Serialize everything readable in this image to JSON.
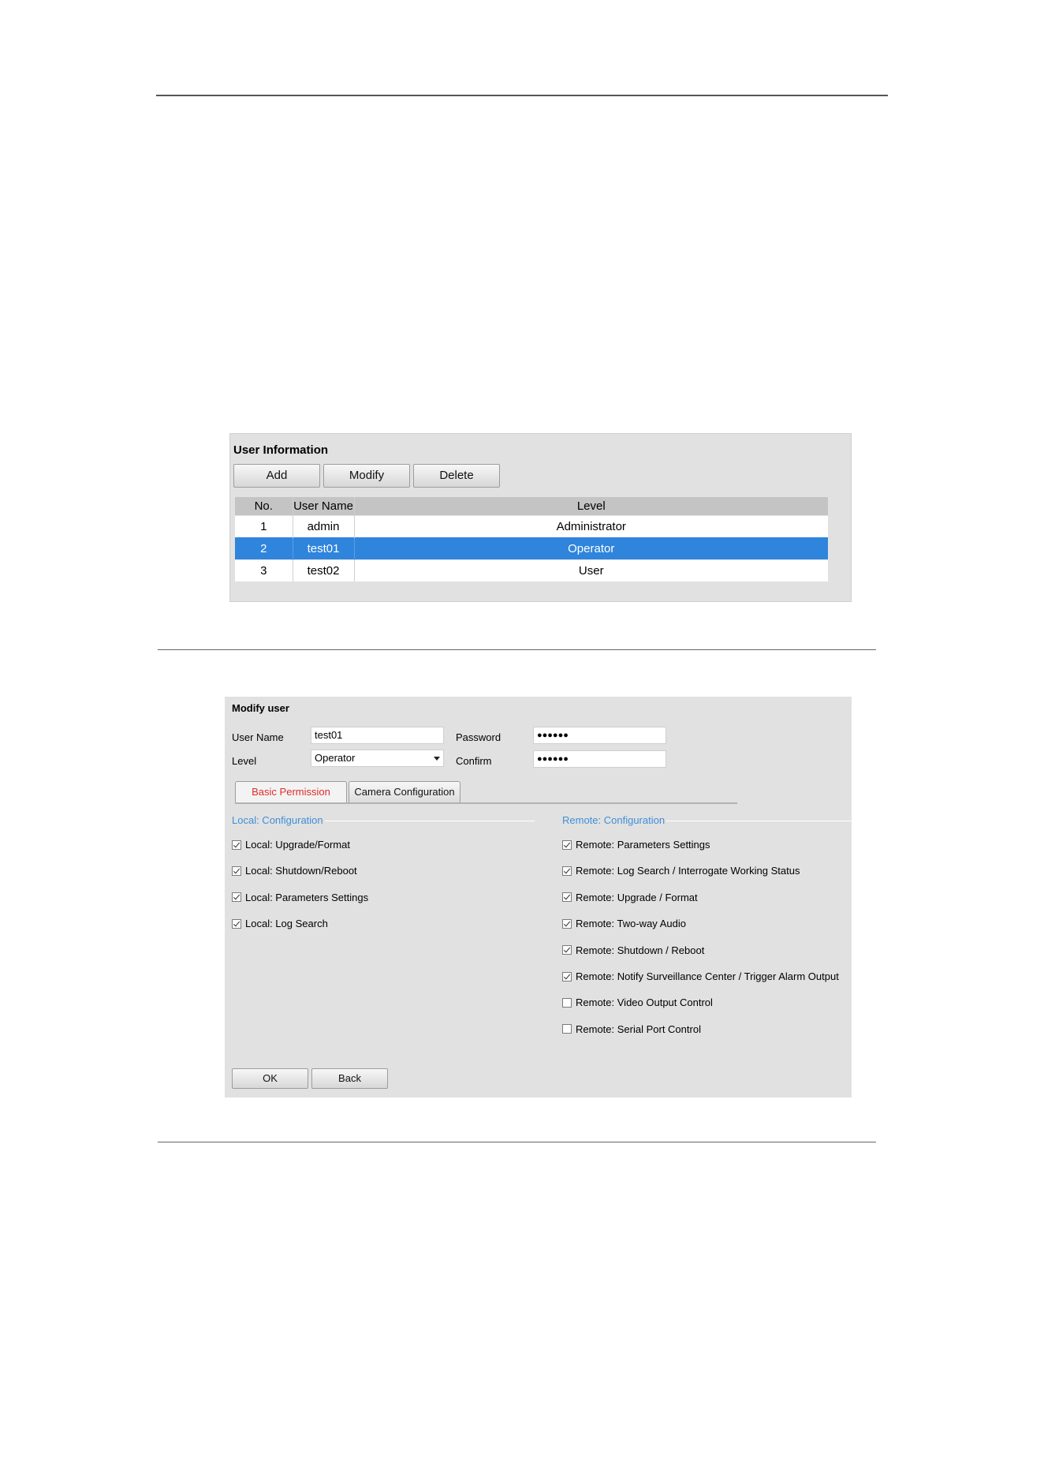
{
  "user_information": {
    "title": "User Information",
    "buttons": {
      "add": "Add",
      "modify": "Modify",
      "delete": "Delete"
    },
    "columns": [
      "No.",
      "User Name",
      "Level"
    ],
    "rows": [
      {
        "no": "1",
        "user_name": "admin",
        "level": "Administrator",
        "selected": false
      },
      {
        "no": "2",
        "user_name": "test01",
        "level": "Operator",
        "selected": true
      },
      {
        "no": "3",
        "user_name": "test02",
        "level": "User",
        "selected": false
      }
    ]
  },
  "modify_user": {
    "title": "Modify user",
    "user_name_label": "User Name",
    "user_name_value": "test01",
    "password_label": "Password",
    "password_value": "●●●●●●",
    "level_label": "Level",
    "level_value": "Operator",
    "confirm_label": "Confirm",
    "confirm_value": "●●●●●●",
    "tabs": [
      "Basic Permission",
      "Camera Configuration"
    ],
    "active_tab": "Basic Permission",
    "local_group_title": "Local: Configuration",
    "remote_group_title": "Remote: Configuration",
    "local_permissions": [
      {
        "label": "Local: Upgrade/Format",
        "checked": true
      },
      {
        "label": "Local: Shutdown/Reboot",
        "checked": true
      },
      {
        "label": "Local: Parameters Settings",
        "checked": true
      },
      {
        "label": "Local: Log Search",
        "checked": true
      }
    ],
    "remote_permissions": [
      {
        "label": "Remote: Parameters Settings",
        "checked": true
      },
      {
        "label": "Remote: Log Search / Interrogate Working Status",
        "checked": true
      },
      {
        "label": "Remote: Upgrade / Format",
        "checked": true
      },
      {
        "label": "Remote: Two-way Audio",
        "checked": true
      },
      {
        "label": "Remote: Shutdown / Reboot",
        "checked": true
      },
      {
        "label": "Remote: Notify Surveillance Center / Trigger Alarm Output",
        "checked": true
      },
      {
        "label": "Remote: Video Output Control",
        "checked": false
      },
      {
        "label": "Remote: Serial Port Control",
        "checked": false
      }
    ],
    "ok_label": "OK",
    "back_label": "Back"
  },
  "colors": {
    "selection": "#2f84dc",
    "panel": "#e1e1e1",
    "group_title": "#3f8fd8",
    "active_tab_text": "#e02b2b"
  }
}
